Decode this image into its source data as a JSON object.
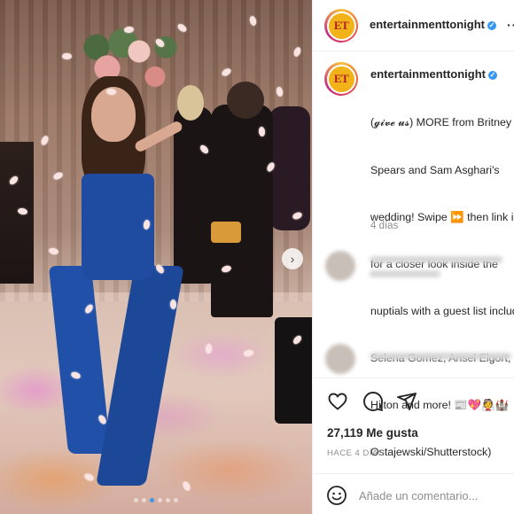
{
  "post": {
    "account": {
      "username": "entertainmenttonight",
      "avatar_text": "ET",
      "verified_symbol": "✓"
    },
    "more_symbol": "···",
    "caption_lines": [
      "(𝓰𝓲𝓿𝓮 𝓾𝓼) MORE from Britney",
      "Spears and Sam Asghari's",
      "wedding! Swipe ⏩ then link in bio",
      "for a closer look inside the",
      "nuptials with a guest list including",
      "Selena Gomez, Ansel Elgort, Paris",
      "Hilton and more! 📰💖👰🏰",
      "Ostajewski/Shutterstock)"
    ],
    "time_ago": "4 días",
    "likes": "27,119 Me gusta",
    "date": "HACE 4 DÍAS",
    "comment_placeholder": "Añade un comentario...",
    "next_symbol": "›"
  },
  "carousel": {
    "slides": 6,
    "active_index": 2
  },
  "colors": {
    "accent_blue": "#3897f0",
    "text_primary": "#262626",
    "text_secondary": "#8e8e8e",
    "divider": "#efefef"
  },
  "icons": [
    "heart-icon",
    "comment-icon",
    "share-icon",
    "emoji-icon",
    "verified-icon",
    "more-icon",
    "chevron-right-icon"
  ]
}
